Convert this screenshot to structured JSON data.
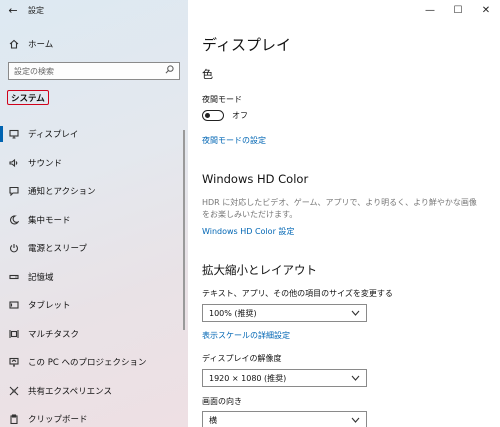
{
  "window": {
    "app_title": "設定",
    "back_icon": "arrow-left-icon",
    "minimize": "—",
    "maximize": "☐",
    "close": "✕"
  },
  "sidebar": {
    "home_label": "ホーム",
    "search_placeholder": "設定の検索",
    "section_label": "システム",
    "items": [
      {
        "label": "ディスプレイ",
        "icon": "monitor-icon"
      },
      {
        "label": "サウンド",
        "icon": "speaker-icon"
      },
      {
        "label": "通知とアクション",
        "icon": "notification-icon"
      },
      {
        "label": "集中モード",
        "icon": "moon-icon"
      },
      {
        "label": "電源とスリープ",
        "icon": "power-icon"
      },
      {
        "label": "記憶域",
        "icon": "storage-icon"
      },
      {
        "label": "タブレット",
        "icon": "tablet-icon"
      },
      {
        "label": "マルチタスク",
        "icon": "multitask-icon"
      },
      {
        "label": "この PC へのプロジェクション",
        "icon": "projection-icon"
      },
      {
        "label": "共有エクスペリエンス",
        "icon": "shared-experience-icon"
      },
      {
        "label": "クリップボード",
        "icon": "clipboard-icon"
      }
    ]
  },
  "main": {
    "title": "ディスプレイ",
    "color_heading": "色",
    "night_mode_label": "夜間モード",
    "night_mode_state": "オフ",
    "night_mode_link": "夜間モードの設定",
    "hdr_heading": "Windows HD Color",
    "hdr_desc": "HDR に対応したビデオ、ゲーム、アプリで、より明るく、より鮮やかな画像をお楽しみいただけます。",
    "hdr_link": "Windows HD Color 設定",
    "scale_heading": "拡大縮小とレイアウト",
    "scale_label": "テキスト、アプリ、その他の項目のサイズを変更する",
    "scale_value": "100% (推奨)",
    "scale_link": "表示スケールの詳細設定",
    "resolution_label": "ディスプレイの解像度",
    "resolution_value": "1920 × 1080 (推奨)",
    "orientation_label": "画面の向き",
    "orientation_value": "横"
  }
}
